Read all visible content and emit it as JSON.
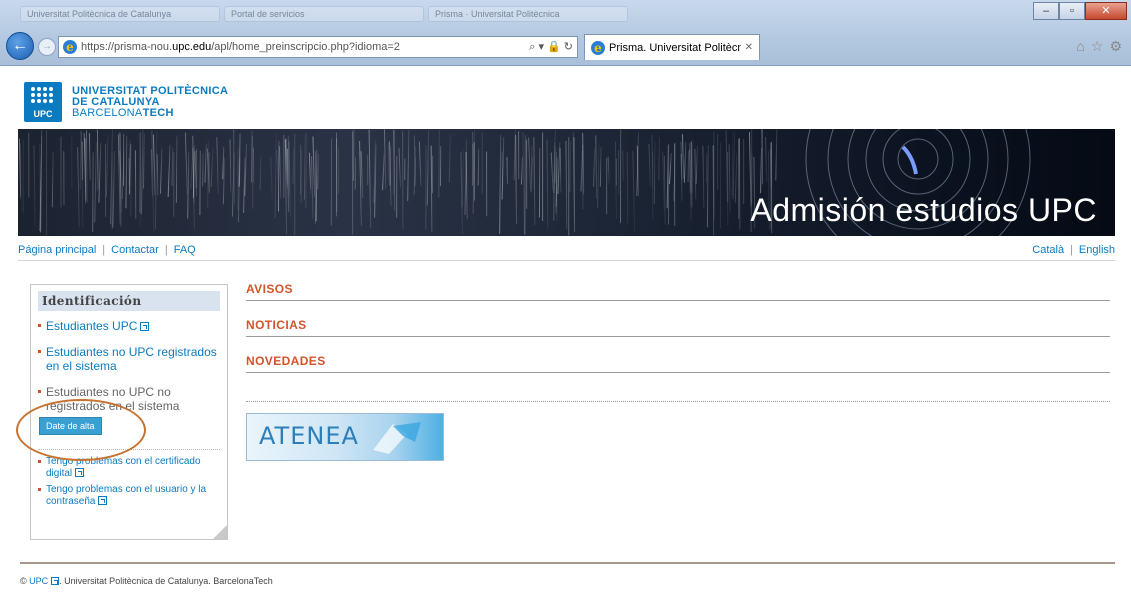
{
  "browser": {
    "bg_tabs": [
      "Universitat Politècnica de Catalunya",
      "Portal de servicios",
      "Prisma · Universitat Politècnica"
    ],
    "url_prefix": "https://prisma-nou.",
    "url_domain": "upc.edu",
    "url_path": "/apl/home_preinscripcio.php?idioma=2",
    "addr_tools": "⌕ ▾ 🔒 ↻",
    "active_tab_title": "Prisma. Universitat Politècn...",
    "tab_close": "✕",
    "back": "←",
    "forward": "→",
    "window_buttons": {
      "minimize": "‒",
      "maximize": "▫",
      "close": "✕"
    },
    "right_icons": [
      "⌂",
      "☆",
      "⚙"
    ]
  },
  "header": {
    "logo_text": "UPC",
    "name_line1": "UNIVERSITAT POLITÈCNICA",
    "name_line2": "DE CATALUNYA",
    "name_line3a": "BARCELONA",
    "name_line3b": "TECH"
  },
  "banner": {
    "title": "Admisión estudios UPC"
  },
  "topnav": {
    "left": [
      "Página principal",
      "Contactar",
      "FAQ"
    ],
    "right": [
      "Català",
      "English"
    ],
    "separator": "|"
  },
  "sidebar": {
    "title": "Identificación",
    "item1": "Estudiantes UPC",
    "item2": "Estudiantes no UPC registrados en el sistema",
    "item3": "Estudiantes no UPC no registrados en el sistema",
    "alta_button": "Date de alta",
    "help1": "Tengo problemas con el certificado digital",
    "help2": "Tengo problemas con el usuario y la contraseña"
  },
  "main": {
    "sections": [
      "AVISOS",
      "NOTICIAS",
      "NOVEDADES"
    ],
    "atenea_label": "ATENEA"
  },
  "footer": {
    "copyright": "©",
    "link": "UPC",
    "text": ". Universitat Politècnica de Catalunya. BarcelonaTech"
  }
}
